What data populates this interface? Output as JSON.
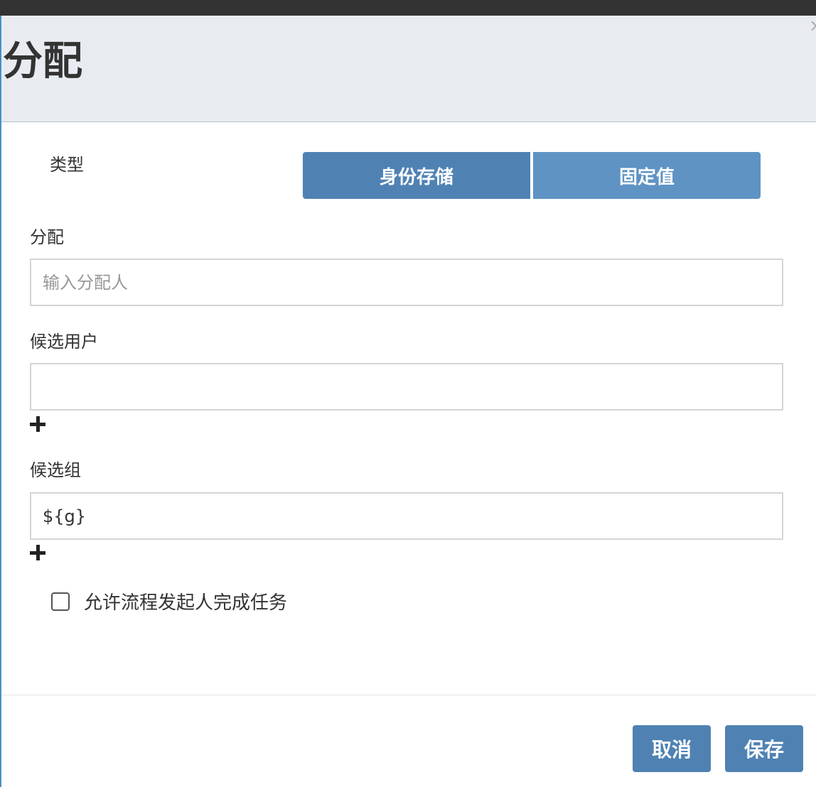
{
  "dialog": {
    "title": "分配",
    "close_icon": "×"
  },
  "type_section": {
    "label": "类型",
    "options": [
      "身份存储",
      "固定值"
    ],
    "selected": "身份存储"
  },
  "assignee": {
    "label": "分配",
    "value": "",
    "placeholder": "输入分配人"
  },
  "candidate_users": {
    "label": "候选用户",
    "values": [
      ""
    ],
    "add_icon": "plus-icon"
  },
  "candidate_groups": {
    "label": "候选组",
    "values": [
      "${g}"
    ],
    "add_icon": "plus-icon"
  },
  "initiator_option": {
    "label": "允许流程发起人完成任务",
    "checked": false
  },
  "footer": {
    "cancel_label": "取消",
    "save_label": "保存"
  },
  "colors": {
    "primary_button": "#4f82b3",
    "secondary_toggle": "#5f93c3",
    "header_background": "#e8ecf1"
  }
}
